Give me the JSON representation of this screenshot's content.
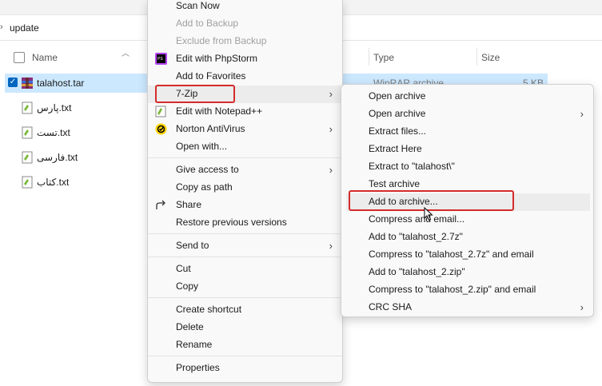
{
  "explorer": {
    "path": "update",
    "columns": {
      "name": "Name",
      "type": "Type",
      "size": "Size"
    },
    "files": [
      {
        "name": "talahost.tar",
        "type": "WinRAR archive",
        "size": "5 KB",
        "selected": true
      },
      {
        "name": "پارس.txt"
      },
      {
        "name": "تست.txt"
      },
      {
        "name": "فارسی.txt"
      },
      {
        "name": "کتاب.txt"
      }
    ]
  },
  "context_menu": {
    "items": {
      "scan_now": "Scan Now",
      "add_to_backup": "Add to Backup",
      "exclude_from_backup": "Exclude from Backup",
      "edit_phpstorm": "Edit with PhpStorm",
      "add_to_favorites": "Add to Favorites",
      "seven_zip": "7-Zip",
      "edit_notepad": "Edit with Notepad++",
      "norton": "Norton AntiVirus",
      "open_with": "Open with...",
      "give_access": "Give access to",
      "copy_as_path": "Copy as path",
      "share": "Share",
      "restore_previous": "Restore previous versions",
      "send_to": "Send to",
      "cut": "Cut",
      "copy": "Copy",
      "create_shortcut": "Create shortcut",
      "delete": "Delete",
      "rename": "Rename",
      "properties": "Properties"
    }
  },
  "submenu_7zip": {
    "items": {
      "open_archive": "Open archive",
      "open_archive_sub": "Open archive",
      "extract_files": "Extract files...",
      "extract_here": "Extract Here",
      "extract_to": "Extract to \"talahost\\\"",
      "test_archive": "Test archive",
      "add_to_archive": "Add to archive...",
      "compress_email": "Compress and email...",
      "add_to_7z": "Add to \"talahost_2.7z\"",
      "compress_7z_email": "Compress to \"talahost_2.7z\" and email",
      "add_to_zip": "Add to \"talahost_2.zip\"",
      "compress_zip_email": "Compress to \"talahost_2.zip\" and email",
      "crc_sha": "CRC SHA"
    }
  },
  "colors": {
    "highlight_border": "#d42b2b",
    "selection": "#cce8ff",
    "accent": "#0067c0"
  }
}
